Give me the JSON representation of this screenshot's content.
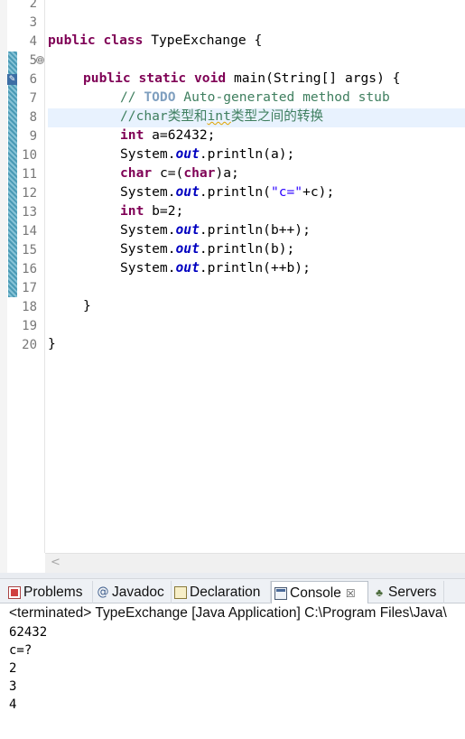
{
  "editor": {
    "line_numbers": [
      "2",
      "3",
      "4",
      "5",
      "6",
      "7",
      "8",
      "9",
      "10",
      "11",
      "12",
      "13",
      "14",
      "15",
      "16",
      "17",
      "18",
      "19",
      "20"
    ],
    "code": {
      "l3_kw": "public class",
      "l3_rest": " TypeExchange {",
      "l5_kw": "public static void",
      "l5_rest": " main(String[] args) {",
      "l6_prefix": "// ",
      "l6_todo": "TODO",
      "l6_rest": " Auto-generated method stub",
      "l7_a": "//char",
      "l7_b": "类型和",
      "l7_c": "int",
      "l7_d": "类型之间的转换",
      "l8_kw": "int",
      "l8_rest": " a=62432;",
      "l9_a": "System.",
      "l9_out": "out",
      "l9_b": ".println(a);",
      "l10_kw1": "char",
      "l10_a": " c=(",
      "l10_kw2": "char",
      "l10_b": ")a;",
      "l11_a": "System.",
      "l11_out": "out",
      "l11_b": ".println(",
      "l11_str": "\"c=\"",
      "l11_c": "+c);",
      "l12_kw": "int",
      "l12_rest": " b=2;",
      "l13_a": "System.",
      "l13_out": "out",
      "l13_b": ".println(b++);",
      "l14_a": "System.",
      "l14_out": "out",
      "l14_b": ".println(b);",
      "l15_a": "System.",
      "l15_out": "out",
      "l15_b": ".println(++b);",
      "l17": "}",
      "l19": "}"
    },
    "fold_symbol": "⊖",
    "scroll_left_arrow": "<"
  },
  "views": {
    "tabs": [
      {
        "label": "Problems",
        "icon": "problems-icon"
      },
      {
        "label": "Javadoc",
        "icon": "javadoc-icon",
        "glyph": "@"
      },
      {
        "label": "Declaration",
        "icon": "declaration-icon"
      },
      {
        "label": "Console",
        "icon": "console-icon",
        "active": true,
        "close": "☒"
      },
      {
        "label": "Servers",
        "icon": "servers-icon",
        "glyph": "♣"
      }
    ]
  },
  "console": {
    "header": "<terminated> TypeExchange [Java Application] C:\\Program Files\\Java\\",
    "output": [
      "62432",
      "c=?",
      "2",
      "3",
      "4"
    ]
  },
  "colors": {
    "keyword": "#7f0055",
    "comment": "#3f7f5f",
    "field": "#0000c0",
    "string": "#2a00ff",
    "current_line": "#e8f2fe"
  }
}
